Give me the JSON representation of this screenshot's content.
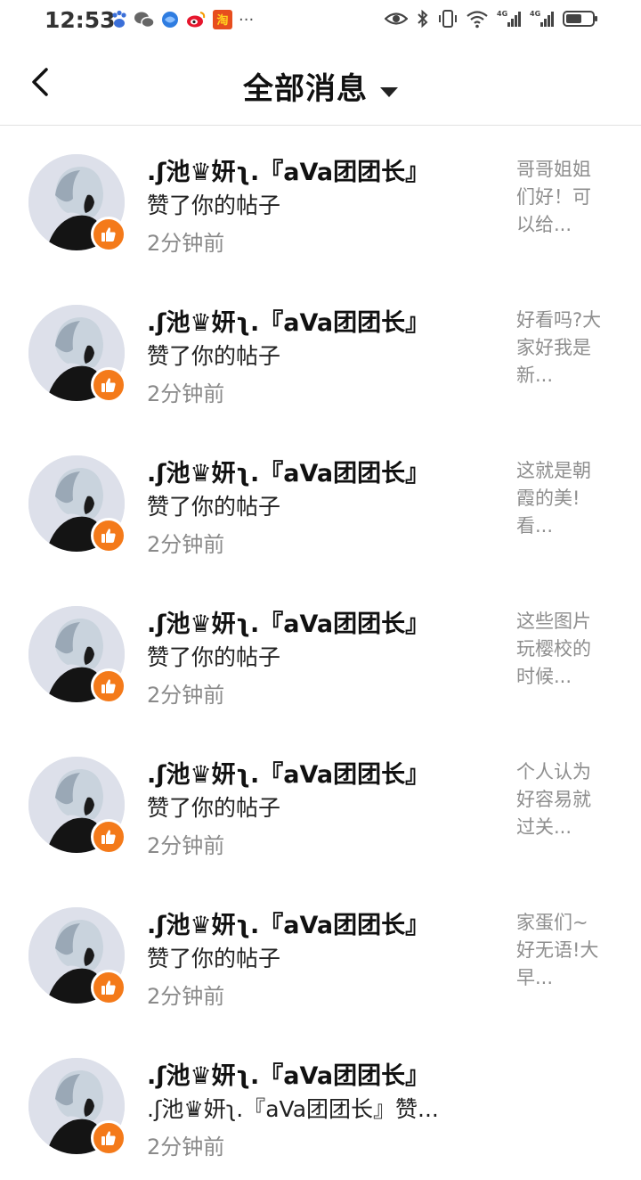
{
  "status_bar": {
    "time": "12:53",
    "notification_icons": [
      "baidu-paw-icon",
      "wechat-icon",
      "browser-icon",
      "weibo-icon",
      "taobao-icon"
    ],
    "more": "···"
  },
  "header": {
    "title": "全部消息"
  },
  "messages": [
    {
      "name": ".ʃ池♛妍ʅ.『aVa团团长』",
      "action": "赞了你的帖子",
      "time": "2分钟前",
      "preview": "哥哥姐姐们好！可以给..."
    },
    {
      "name": ".ʃ池♛妍ʅ.『aVa团团长』",
      "action": "赞了你的帖子",
      "time": "2分钟前",
      "preview": "好看吗?大家好我是新..."
    },
    {
      "name": ".ʃ池♛妍ʅ.『aVa团团长』",
      "action": "赞了你的帖子",
      "time": "2分钟前",
      "preview": "这就是朝霞的美!看..."
    },
    {
      "name": ".ʃ池♛妍ʅ.『aVa团团长』",
      "action": "赞了你的帖子",
      "time": "2分钟前",
      "preview": "这些图片玩樱校的时候..."
    },
    {
      "name": ".ʃ池♛妍ʅ.『aVa团团长』",
      "action": "赞了你的帖子",
      "time": "2分钟前",
      "preview": "个人认为好容易就过关..."
    },
    {
      "name": ".ʃ池♛妍ʅ.『aVa团团长』",
      "action": "赞了你的帖子",
      "time": "2分钟前",
      "preview": "家蛋们~好无语!大早..."
    },
    {
      "name": ".ʃ池♛妍ʅ.『aVa团团长』",
      "action": ".ʃ池♛妍ʅ.『aVa团团长』赞...",
      "time": "2分钟前",
      "preview": ""
    }
  ],
  "colors": {
    "like_badge": "#f47a1a",
    "secondary_text": "#8a8a8a",
    "divider": "#e2e2e2"
  }
}
